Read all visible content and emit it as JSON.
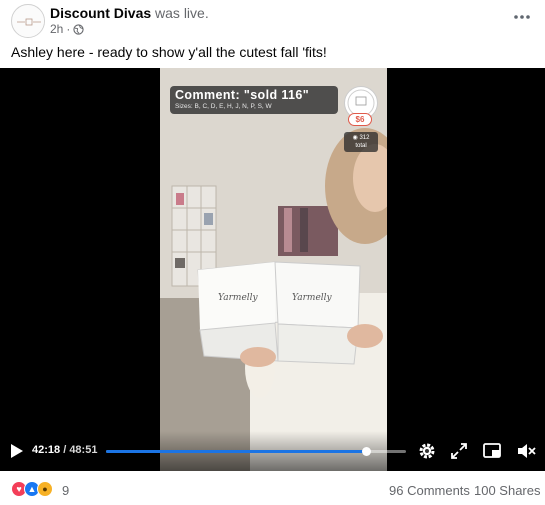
{
  "post": {
    "page_name": "Discount Divas",
    "status": "was live.",
    "time": "2h",
    "separator": "·",
    "caption": "Ashley here - ready to show y'all the cutest fall 'fits!"
  },
  "video": {
    "comment_overlay": "Comment: \"sold 116\"",
    "sizes_line": "Sizes: B, C, D, E, H, J, N, P, S, W",
    "price": "$6",
    "viewer_count": "312",
    "viewer_label": "total",
    "current_time": "42:18",
    "time_separator": " / ",
    "total_time": "48:51",
    "progress": 0.866
  },
  "engagement": {
    "reaction_count": "9",
    "comments": "96 Comments",
    "shares": "100 Shares",
    "reactions": [
      "love-reaction-icon",
      "like-reaction-icon",
      "wow-reaction-icon"
    ]
  },
  "colors": {
    "accent": "#1b74e4",
    "love": "#f33e58",
    "like": "#1877f2",
    "wow": "#f7b125",
    "secondary_text": "#65676b"
  }
}
